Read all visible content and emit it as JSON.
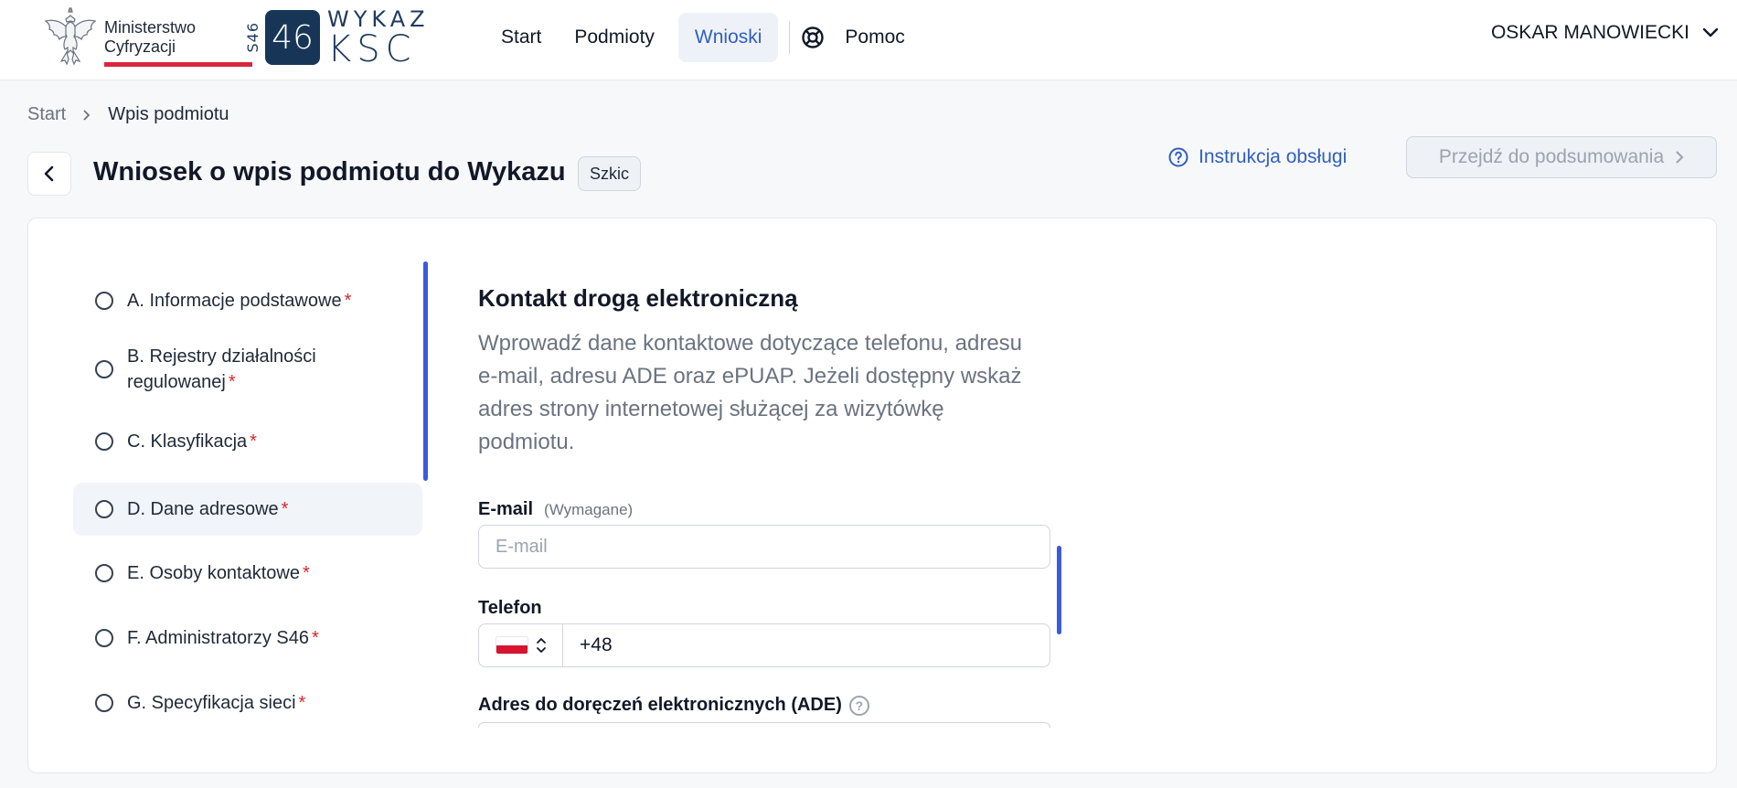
{
  "header": {
    "ministry": {
      "line1": "Ministerstwo",
      "line2": "Cyfryzacji"
    },
    "ksc_logo": {
      "vertical": "S46",
      "box": "46",
      "word1": "WYKAZ",
      "word2": "KSC"
    },
    "nav": [
      {
        "label": "Start",
        "active": false
      },
      {
        "label": "Podmioty",
        "active": false
      },
      {
        "label": "Wnioski",
        "active": true
      }
    ],
    "help_label": "Pomoc",
    "user_name": "OSKAR MANOWIECKI"
  },
  "breadcrumb": {
    "start": "Start",
    "current": "Wpis podmiotu"
  },
  "page": {
    "title": "Wniosek o wpis podmiotu do Wykazu",
    "status": "Szkic",
    "instructions_label": "Instrukcja obsługi",
    "summary_button": "Przejdź do podsumowania"
  },
  "steps": [
    {
      "label": "A. Informacje podstawowe",
      "required": "*"
    },
    {
      "label": "B. Rejestry działalności regulowanej",
      "required": "*"
    },
    {
      "label": "C. Klasyfikacja",
      "required": "*"
    },
    {
      "label": "D. Dane adresowe",
      "required": "*",
      "active": true
    },
    {
      "label": "E. Osoby kontaktowe",
      "required": "*"
    },
    {
      "label": "F. Administratorzy S46",
      "required": "*"
    },
    {
      "label": "G. Specyfikacja sieci",
      "required": "*"
    }
  ],
  "form": {
    "title": "Kontakt drogą elektroniczną",
    "description": "Wprowadź dane kontaktowe dotyczące telefonu, adresu e-mail, adresu ADE oraz ePUAP. Jeżeli dostępny wskaż adres strony internetowej służącej za wizytówkę podmiotu.",
    "email": {
      "label": "E-mail",
      "hint": "(Wymagane)",
      "placeholder": "E-mail",
      "value": ""
    },
    "phone": {
      "label": "Telefon",
      "country": "PL",
      "value": "+48"
    },
    "ade": {
      "label": "Adres do doręczeń elektronicznych (ADE)"
    }
  },
  "colors": {
    "accent": "#2f5fbf",
    "required": "#dc2626",
    "scrollbar": "#3b5bdb"
  }
}
